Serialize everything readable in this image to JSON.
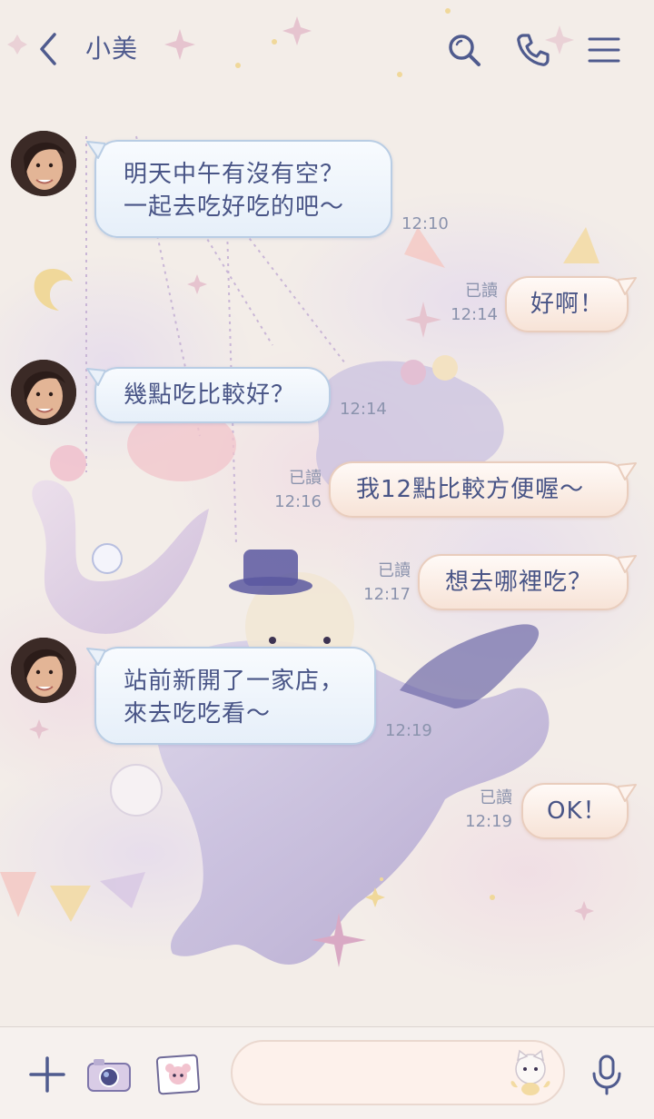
{
  "header": {
    "contact_name": "小美"
  },
  "messages": [
    {
      "direction": "in",
      "lines": [
        "明天中午有沒有空？",
        "一起去吃好吃的吧～"
      ],
      "time": "12:10"
    },
    {
      "direction": "out",
      "lines": [
        "好啊！"
      ],
      "read": "已讀",
      "time": "12:14"
    },
    {
      "direction": "in",
      "lines": [
        "幾點吃比較好？"
      ],
      "time": "12:14"
    },
    {
      "direction": "out",
      "lines": [
        "我12點比較方便喔～"
      ],
      "read": "已讀",
      "time": "12:16"
    },
    {
      "direction": "out",
      "lines": [
        "想去哪裡吃？"
      ],
      "read": "已讀",
      "time": "12:17"
    },
    {
      "direction": "in",
      "lines": [
        "站前新開了一家店，",
        "來去吃吃看～"
      ],
      "time": "12:19"
    },
    {
      "direction": "out",
      "lines": [
        "OK！"
      ],
      "read": "已讀",
      "time": "12:19"
    }
  ],
  "footer": {
    "input_value": "",
    "input_placeholder": ""
  },
  "theme": {
    "accent": "#4f5b8e",
    "in_bubble": "#e6eff9",
    "out_bubble": "#f7e3d7",
    "background": "#f3ede8"
  },
  "icons": {
    "back": "chevron-left-icon",
    "search": "search-icon",
    "call": "phone-icon",
    "menu": "menu-icon",
    "add": "plus-icon",
    "camera": "camera-icon",
    "gallery": "image-icon",
    "sticker": "sticker-icon",
    "mic": "microphone-icon"
  }
}
